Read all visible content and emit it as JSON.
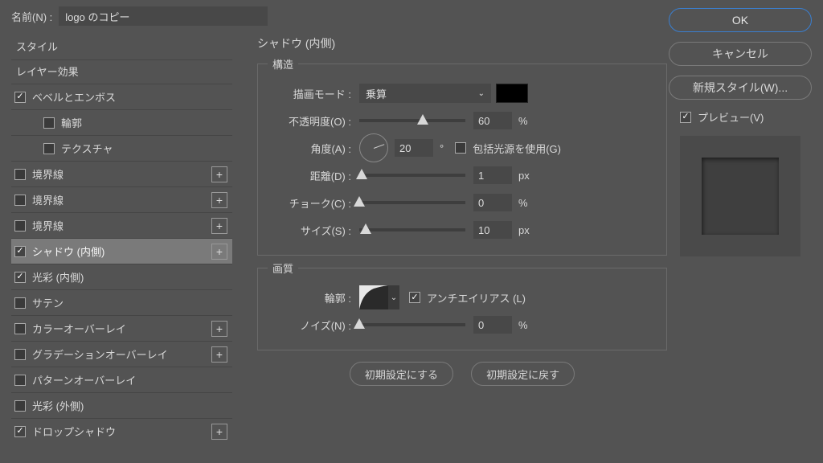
{
  "nameRow": {
    "label": "名前(N) :",
    "value": "logo のコピー"
  },
  "left": {
    "style": "スタイル",
    "effects": "レイヤー効果",
    "items": [
      {
        "label": "ベベルとエンボス",
        "checked": true,
        "plus": false
      },
      {
        "label": "輪郭",
        "checked": false,
        "sub": true
      },
      {
        "label": "テクスチャ",
        "checked": false,
        "sub": true
      },
      {
        "label": "境界線",
        "checked": false,
        "plus": true
      },
      {
        "label": "境界線",
        "checked": false,
        "plus": true
      },
      {
        "label": "境界線",
        "checked": false,
        "plus": true
      },
      {
        "label": "シャドウ (内側)",
        "checked": true,
        "plus": true,
        "selected": true
      },
      {
        "label": "光彩 (内側)",
        "checked": true
      },
      {
        "label": "サテン",
        "checked": false
      },
      {
        "label": "カラーオーバーレイ",
        "checked": false,
        "plus": true
      },
      {
        "label": "グラデーションオーバーレイ",
        "checked": false,
        "plus": true
      },
      {
        "label": "パターンオーバーレイ",
        "checked": false
      },
      {
        "label": "光彩 (外側)",
        "checked": false
      },
      {
        "label": "ドロップシャドウ",
        "checked": true,
        "plus": true
      }
    ]
  },
  "center": {
    "title": "シャドウ (内側)",
    "structure": {
      "legend": "構造",
      "blendLabel": "描画モード :",
      "blendValue": "乗算",
      "opacityLabel": "不透明度(O) :",
      "opacity": "60",
      "opacityUnit": "%",
      "angleLabel": "角度(A) :",
      "angle": "20",
      "angleUnit": "°",
      "globalLight": "包括光源を使用(G)",
      "distanceLabel": "距離(D) :",
      "distance": "1",
      "distanceUnit": "px",
      "chokeLabel": "チョーク(C) :",
      "choke": "0",
      "chokeUnit": "%",
      "sizeLabel": "サイズ(S) :",
      "size": "10",
      "sizeUnit": "px"
    },
    "quality": {
      "legend": "画質",
      "contourLabel": "輪郭 :",
      "antiAlias": "アンチエイリアス (L)",
      "noiseLabel": "ノイズ(N) :",
      "noise": "0",
      "noiseUnit": "%"
    },
    "makeDefault": "初期設定にする",
    "resetDefault": "初期設定に戻す"
  },
  "right": {
    "ok": "OK",
    "cancel": "キャンセル",
    "newStyle": "新規スタイル(W)...",
    "preview": "プレビュー(V)"
  }
}
